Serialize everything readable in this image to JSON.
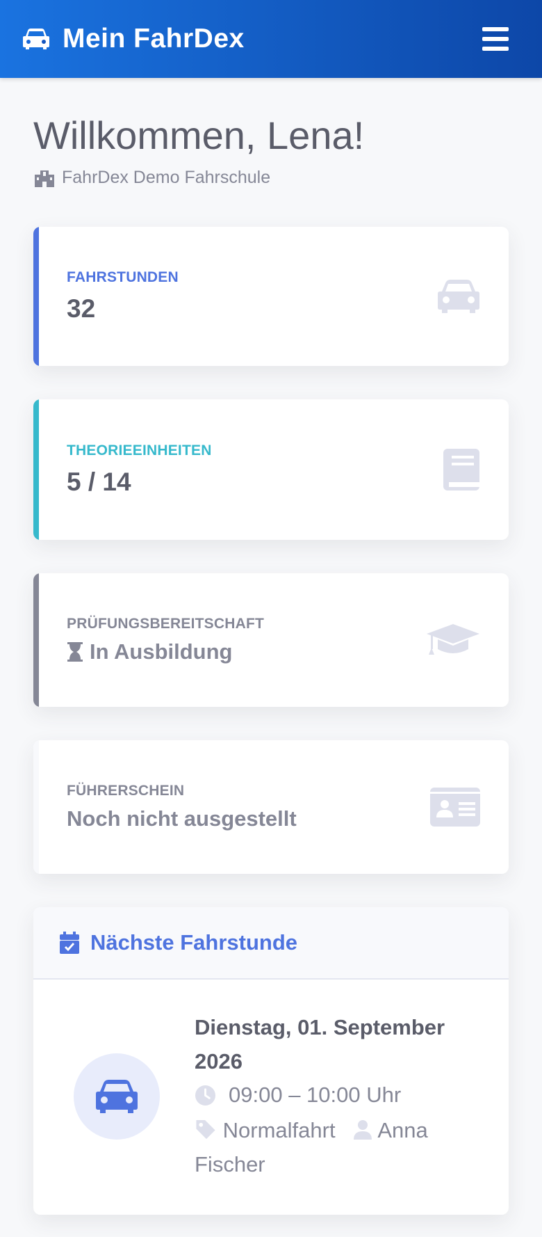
{
  "navbar": {
    "brand": "Mein FahrDex",
    "brand_icon": "car-icon",
    "menu_icon": "hamburger-menu-icon",
    "color_start": "#1a73e0",
    "color_end": "#0d47a8"
  },
  "welcome": {
    "title": "Willkommen, Lena!",
    "school": "FahrDex Demo Fahrschule",
    "school_icon": "school-building-icon"
  },
  "stats": [
    {
      "label": "FAHRSTUNDEN",
      "value": "32",
      "accent": "#4e73df",
      "icon": "car-icon"
    },
    {
      "label": "THEORIEEINHEITEN",
      "value": "5 / 14",
      "accent": "#36b9cc",
      "icon": "book-icon"
    },
    {
      "label": "PRÜFUNGSBEREITSCHAFT",
      "value": "In Ausbildung",
      "value_icon": "hourglass-icon",
      "accent": "#858796",
      "icon": "graduation-cap-icon"
    },
    {
      "label": "FÜHRERSCHEIN",
      "value": "Noch nicht ausgestellt",
      "accent": "#f8f9fc",
      "icon": "id-card-icon"
    }
  ],
  "next_lesson": {
    "header": "Nächste Fahrstunde",
    "header_icon": "calendar-check-icon",
    "date": "Dienstag, 01. September 2026",
    "time": "09:00 – 10:00 Uhr",
    "type": "Normalfahrt",
    "instructor": "Anna Fischer",
    "accent": "#4e73df"
  }
}
